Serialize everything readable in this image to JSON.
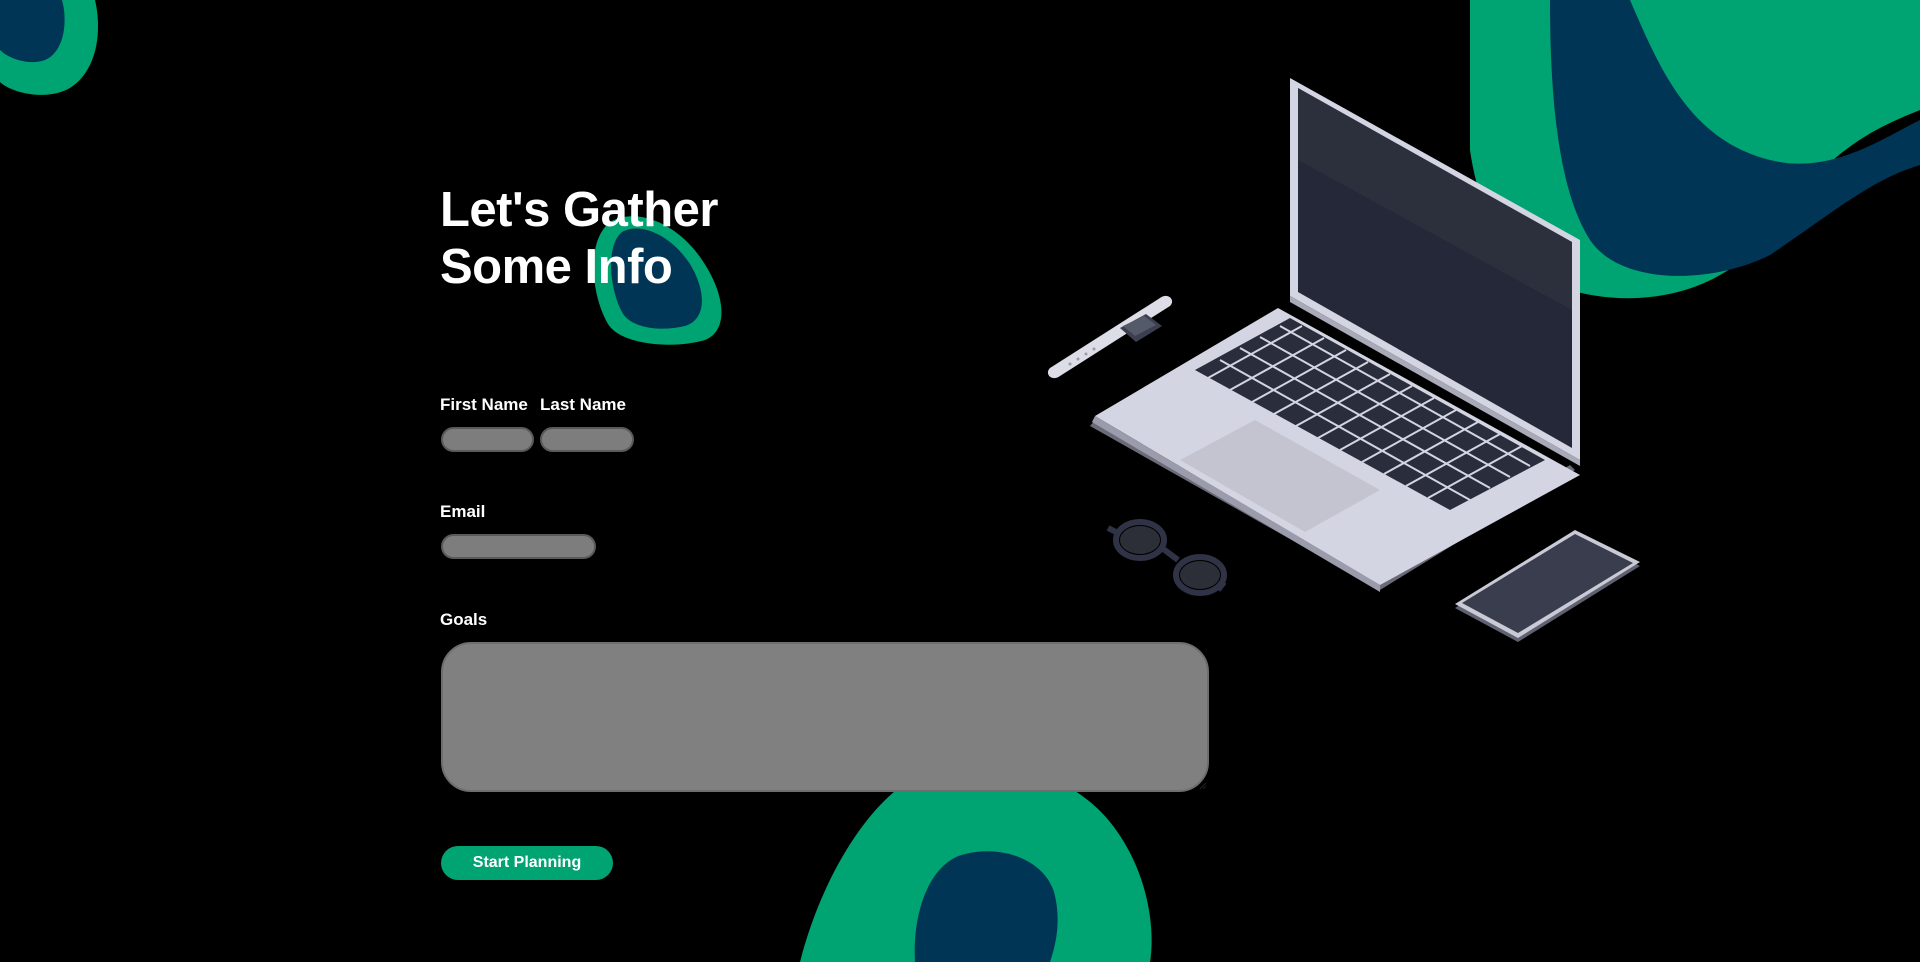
{
  "heading": {
    "line1": "Let's Gather",
    "line2": "Some Info"
  },
  "form": {
    "first_name": {
      "label": "First Name",
      "value": "",
      "placeholder": ""
    },
    "last_name": {
      "label": "Last Name",
      "value": "",
      "placeholder": ""
    },
    "email": {
      "label": "Email",
      "value": "",
      "placeholder": ""
    },
    "goals": {
      "label": "Goals",
      "value": "",
      "placeholder": ""
    },
    "submit_label": "Start Planning"
  },
  "colors": {
    "background": "#000000",
    "accent_green": "#00a372",
    "navy": "#013556",
    "input_fill": "#7d7d7d"
  },
  "decorations": {
    "illustration_items": [
      "laptop-illustration",
      "smartwatch-illustration",
      "glasses-illustration",
      "smartphone-illustration"
    ],
    "blobs": [
      "green-navy-blob-top-left",
      "green-navy-blob-behind-title",
      "green-navy-blob-top-right",
      "green-navy-blob-bottom-center"
    ]
  }
}
